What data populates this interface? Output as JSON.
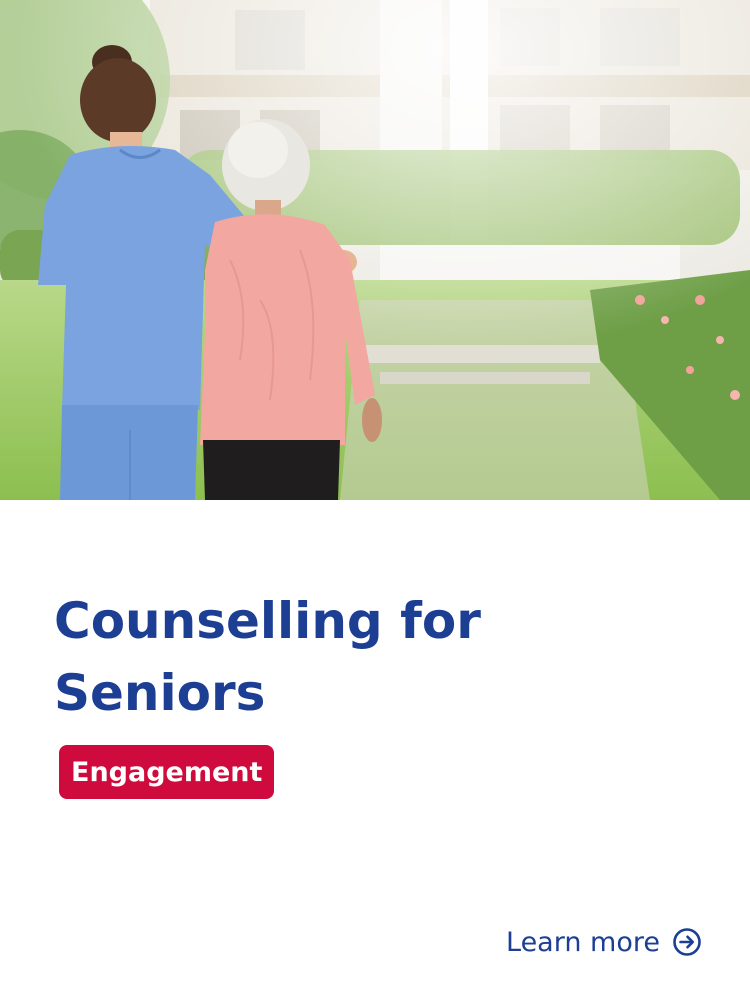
{
  "card": {
    "title": "Counselling for Seniors",
    "tag": "Engagement",
    "link_label": "Learn more",
    "link_icon": "arrow-right-circle-icon",
    "image_subject": "nurse-with-elderly-woman-photo"
  },
  "colors": {
    "title": "#1c3f94",
    "tag_background": "#cf0a3c",
    "tag_text": "#ffffff",
    "link": "#1c3f94"
  }
}
